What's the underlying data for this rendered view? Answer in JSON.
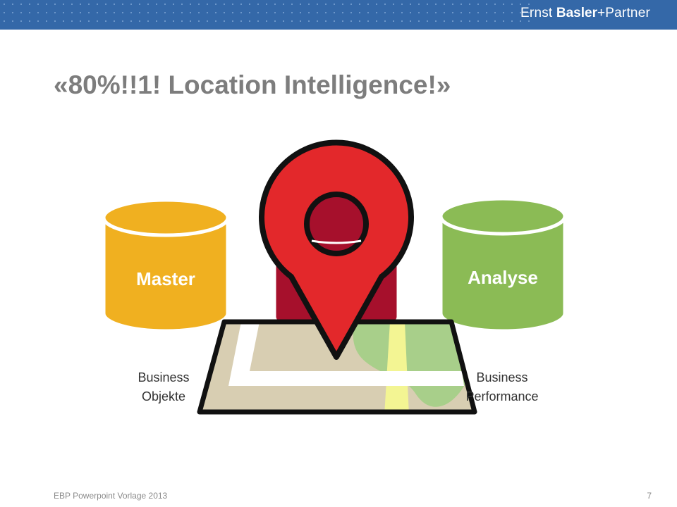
{
  "header": {
    "brand_part1": "Ernst ",
    "brand_part2": "Basler",
    "brand_part3": "+Partner"
  },
  "slide": {
    "title": "«80%!!1! Location Intelligence!»"
  },
  "cylinders": [
    {
      "label": "Master",
      "color": "#f0b020"
    },
    {
      "label": "",
      "color": "#a6102c"
    },
    {
      "label": "Analyse",
      "color": "#8bbb55"
    }
  ],
  "captions": {
    "left_line1": "Business",
    "left_line2": "Objekte",
    "right_line1": "Business",
    "right_line2": "Performance"
  },
  "icons": [
    "map-icon",
    "location-pin-icon"
  ],
  "colors": {
    "header_bar": "#3468a8",
    "pin_red": "#e3282b",
    "map_sand": "#d8ceb2",
    "map_green": "#a8cf8a",
    "map_road_yellow": "#f3f593"
  },
  "footer": {
    "text": "EBP Powerpoint Vorlage 2013",
    "page": "7"
  }
}
